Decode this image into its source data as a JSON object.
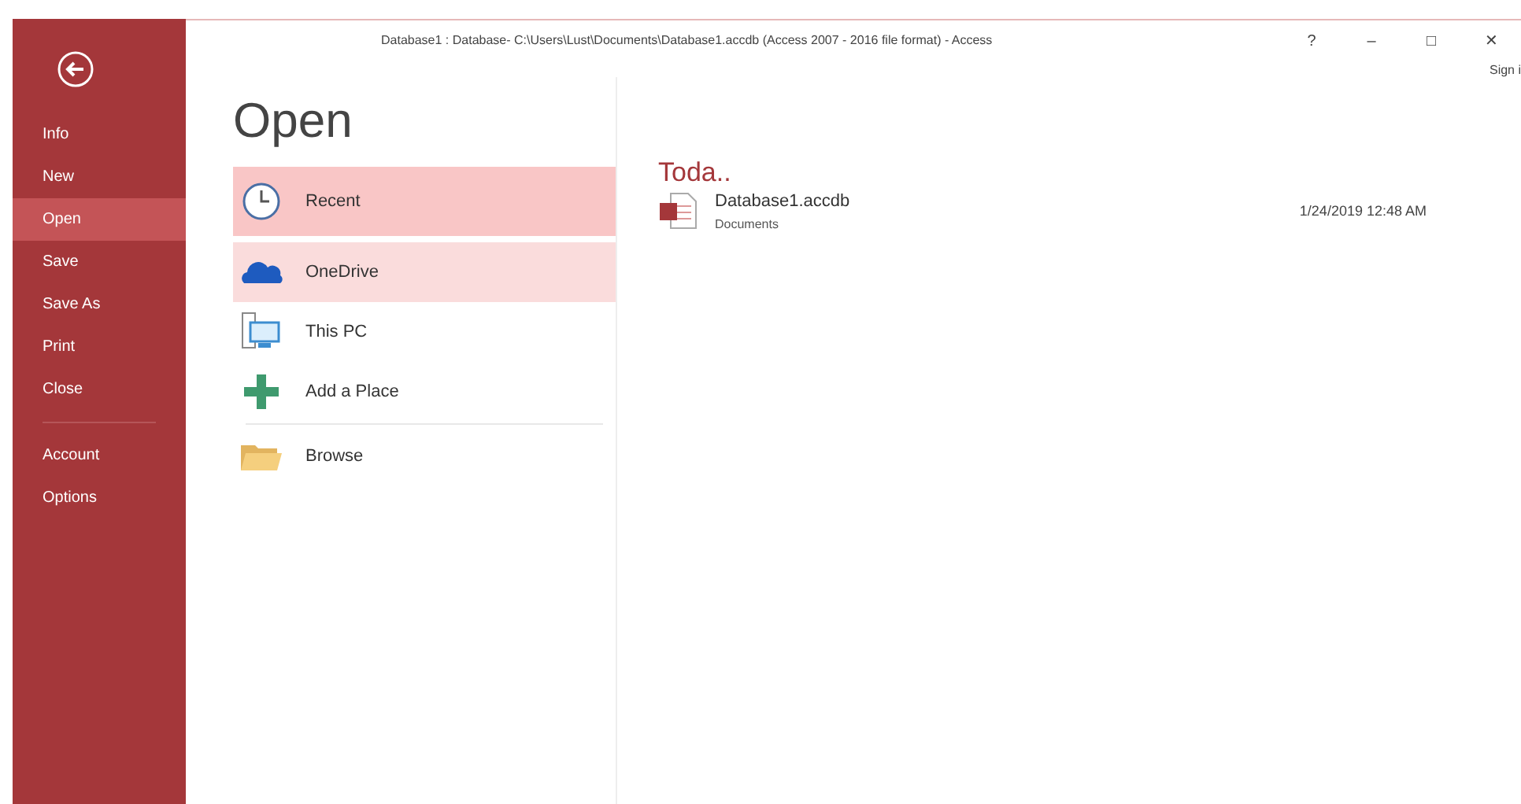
{
  "window": {
    "title": "Database1 : Database- C:\\Users\\Lust\\Documents\\Database1.accdb (Access 2007 - 2016 file format) - Access",
    "controls": [
      {
        "label": "?"
      },
      {
        "label": "–"
      },
      {
        "label": "□"
      },
      {
        "label": "✕"
      }
    ],
    "sign_in": "Sign i"
  },
  "sidebar": {
    "items": [
      {
        "label": "Info",
        "selected": false
      },
      {
        "label": "New",
        "selected": false
      },
      {
        "label": "Open",
        "selected": true
      },
      {
        "label": "Save",
        "selected": false
      },
      {
        "label": "Save As",
        "selected": false
      },
      {
        "label": "Print",
        "selected": false
      },
      {
        "label": "Close",
        "selected": false
      }
    ],
    "bottom_items": [
      {
        "label": "Account",
        "selected": false
      },
      {
        "label": "Options",
        "selected": false
      }
    ]
  },
  "heading": "Open",
  "places": [
    {
      "kind": "recent",
      "label": "Recent",
      "selected": true,
      "hovered": false
    },
    {
      "kind": "onedrive",
      "label": "OneDrive",
      "selected": false,
      "hovered": true
    },
    {
      "kind": "pc",
      "label": "This PC",
      "selected": false,
      "hovered": false
    },
    {
      "kind": "add",
      "label": "Add a Place",
      "selected": false,
      "hovered": false
    },
    {
      "kind": "browse",
      "label": "Browse",
      "selected": false,
      "hovered": false
    }
  ],
  "recent": {
    "group": "Toda..",
    "files": [
      {
        "name": "Database1.accdb",
        "location": "Documents",
        "date": "1/24/2019 12:48 AM"
      }
    ]
  }
}
